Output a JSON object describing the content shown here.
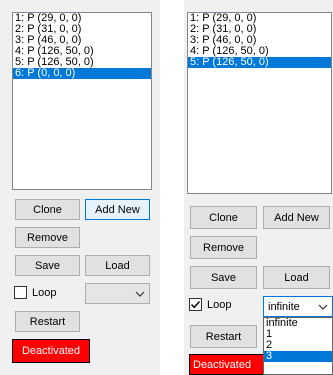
{
  "left_panel": {
    "points": [
      "1: P (29, 0, 0)",
      "2: P (31, 0, 0)",
      "3: P (46, 0, 0)",
      "4: P (126, 50, 0)",
      "5: P (126, 50, 0)",
      "6: P (0, 0, 0)"
    ],
    "selected_index": 5,
    "clone_label": "Clone",
    "add_new_label": "Add New",
    "remove_label": "Remove",
    "save_label": "Save",
    "load_label": "Load",
    "loop_label": "Loop",
    "loop_checked": false,
    "loop_select_value": "",
    "restart_label": "Restart",
    "status_label": "Deactivated",
    "status_color": "#ff0000"
  },
  "right_panel": {
    "points": [
      "1: P (29, 0, 0)",
      "2: P (31, 0, 0)",
      "3: P (46, 0, 0)",
      "4: P (126, 50, 0)",
      "5: P (126, 50, 0)"
    ],
    "selected_index": 4,
    "clone_label": "Clone",
    "add_new_label": "Add New",
    "remove_label": "Remove",
    "save_label": "Save",
    "load_label": "Load",
    "loop_label": "Loop",
    "loop_checked": true,
    "loop_select_value": "infinite",
    "loop_options": [
      "infinite",
      "1",
      "2",
      "3"
    ],
    "highlighted_option_index": 3,
    "restart_label": "Restart",
    "status_label": "Deactivated",
    "status_color": "#ff0000"
  },
  "colors": {
    "selection": "#0078d7",
    "panel_bg": "#f0f0f0"
  },
  "icons": [
    "chevron-down-icon",
    "checkmark-icon"
  ]
}
